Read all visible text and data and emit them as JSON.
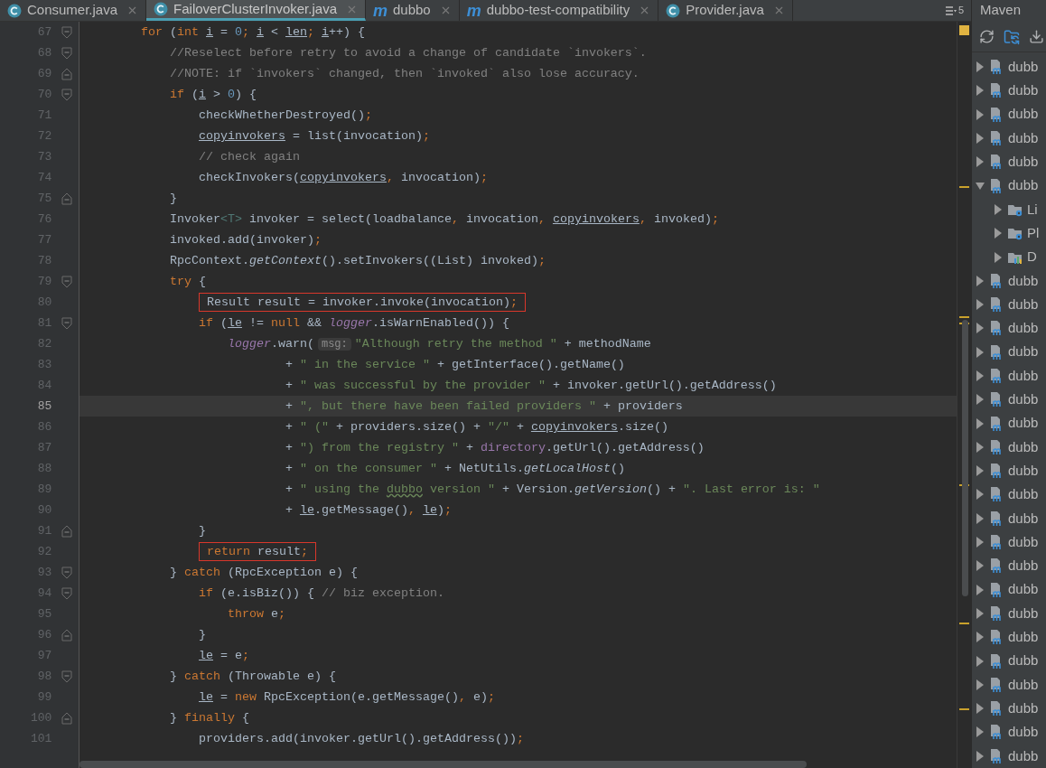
{
  "tabs": [
    {
      "label": "Consumer.java",
      "kind": "class",
      "selected": false
    },
    {
      "label": "FailoverClusterInvoker.java",
      "kind": "class",
      "selected": true
    },
    {
      "label": "dubbo",
      "kind": "maven",
      "icon_char": "m",
      "selected": false
    },
    {
      "label": "dubbo-test-compatibility",
      "kind": "maven",
      "icon_char": "m",
      "selected": false
    },
    {
      "label": "Provider.java",
      "kind": "class",
      "selected": false
    }
  ],
  "hidden_tab_count": "5",
  "editor": {
    "lines": [
      {
        "number": "67",
        "fold_open": true,
        "fold_close": false,
        "current": false,
        "boxed": false,
        "tokens": [
          {
            "kind": "kw",
            "text": "        for"
          },
          {
            "kind": "txt",
            "text": " ("
          },
          {
            "kind": "kw",
            "text": "int "
          },
          {
            "kind": "var",
            "text": "i"
          },
          {
            "kind": "txt",
            "text": " = "
          },
          {
            "kind": "num",
            "text": "0"
          },
          {
            "kind": "kw",
            "text": "; "
          },
          {
            "kind": "var",
            "text": "i"
          },
          {
            "kind": "txt",
            "text": " < "
          },
          {
            "kind": "var",
            "text": "len"
          },
          {
            "kind": "kw",
            "text": "; "
          },
          {
            "kind": "var",
            "text": "i"
          },
          {
            "kind": "txt",
            "text": "++) {"
          }
        ]
      },
      {
        "number": "68",
        "fold_open": true,
        "fold_close": false,
        "current": false,
        "boxed": false,
        "tokens": [
          {
            "kind": "cm",
            "text": "            //Reselect before retry to avoid a change of candidate `invokers`."
          }
        ]
      },
      {
        "number": "69",
        "fold_open": false,
        "fold_close": true,
        "current": false,
        "boxed": false,
        "tokens": [
          {
            "kind": "cm",
            "text": "            //NOTE: if `invokers` changed, then `invoked` also lose accuracy."
          }
        ]
      },
      {
        "number": "70",
        "fold_open": true,
        "fold_close": false,
        "current": false,
        "boxed": false,
        "tokens": [
          {
            "kind": "kw",
            "text": "            if"
          },
          {
            "kind": "txt",
            "text": " ("
          },
          {
            "kind": "var",
            "text": "i"
          },
          {
            "kind": "txt",
            "text": " > "
          },
          {
            "kind": "num",
            "text": "0"
          },
          {
            "kind": "txt",
            "text": ") {"
          }
        ]
      },
      {
        "number": "71",
        "fold_open": false,
        "fold_close": false,
        "current": false,
        "boxed": false,
        "tokens": [
          {
            "kind": "txt",
            "text": "                checkWhetherDestroyed()"
          },
          {
            "kind": "kw",
            "text": ";"
          }
        ]
      },
      {
        "number": "72",
        "fold_open": false,
        "fold_close": false,
        "current": false,
        "boxed": false,
        "tokens": [
          {
            "kind": "var",
            "text": "                copyinvokers"
          },
          {
            "kind": "txt",
            "text": " = list(invocation)"
          },
          {
            "kind": "kw",
            "text": ";"
          }
        ]
      },
      {
        "number": "73",
        "fold_open": false,
        "fold_close": false,
        "current": false,
        "boxed": false,
        "tokens": [
          {
            "kind": "cm",
            "text": "                // check again"
          }
        ]
      },
      {
        "number": "74",
        "fold_open": false,
        "fold_close": false,
        "current": false,
        "boxed": false,
        "tokens": [
          {
            "kind": "txt",
            "text": "                checkInvokers("
          },
          {
            "kind": "var",
            "text": "copyinvokers"
          },
          {
            "kind": "kw",
            "text": ", "
          },
          {
            "kind": "txt",
            "text": "invocation)"
          },
          {
            "kind": "kw",
            "text": ";"
          }
        ]
      },
      {
        "number": "75",
        "fold_open": false,
        "fold_close": true,
        "current": false,
        "boxed": false,
        "tokens": [
          {
            "kind": "txt",
            "text": "            }"
          }
        ]
      },
      {
        "number": "76",
        "fold_open": false,
        "fold_close": false,
        "current": false,
        "boxed": false,
        "tokens": [
          {
            "kind": "txt",
            "text": "            Invoker"
          },
          {
            "kind": "typ",
            "text": "<T>"
          },
          {
            "kind": "txt",
            "text": " invoker = select(loadbalance"
          },
          {
            "kind": "kw",
            "text": ", "
          },
          {
            "kind": "txt",
            "text": "invocation"
          },
          {
            "kind": "kw",
            "text": ", "
          },
          {
            "kind": "var",
            "text": "copyinvokers"
          },
          {
            "kind": "kw",
            "text": ", "
          },
          {
            "kind": "txt",
            "text": "invoked)"
          },
          {
            "kind": "kw",
            "text": ";"
          }
        ]
      },
      {
        "number": "77",
        "fold_open": false,
        "fold_close": false,
        "current": false,
        "boxed": false,
        "tokens": [
          {
            "kind": "txt",
            "text": "            invoked.add(invoker)"
          },
          {
            "kind": "kw",
            "text": ";"
          }
        ]
      },
      {
        "number": "78",
        "fold_open": false,
        "fold_close": false,
        "current": false,
        "boxed": false,
        "tokens": [
          {
            "kind": "txt",
            "text": "            RpcContext."
          },
          {
            "kind": "ital",
            "text": "getContext"
          },
          {
            "kind": "txt",
            "text": "().setInvokers((List) invoked)"
          },
          {
            "kind": "kw",
            "text": ";"
          }
        ]
      },
      {
        "number": "79",
        "fold_open": true,
        "fold_close": false,
        "current": false,
        "boxed": false,
        "tokens": [
          {
            "kind": "kw",
            "text": "            try"
          },
          {
            "kind": "txt",
            "text": " {"
          }
        ]
      },
      {
        "number": "80",
        "fold_open": false,
        "fold_close": false,
        "current": false,
        "boxed": true,
        "tokens": [
          {
            "kind": "txt",
            "text": "                Result result = invoker.invoke(invocation)"
          },
          {
            "kind": "kw",
            "text": ";"
          }
        ]
      },
      {
        "number": "81",
        "fold_open": true,
        "fold_close": false,
        "current": false,
        "boxed": false,
        "tokens": [
          {
            "kind": "kw",
            "text": "                if"
          },
          {
            "kind": "txt",
            "text": " ("
          },
          {
            "kind": "var",
            "text": "le"
          },
          {
            "kind": "txt",
            "text": " != "
          },
          {
            "kind": "kw",
            "text": "null"
          },
          {
            "kind": "txt",
            "text": " && "
          },
          {
            "kind": "fldi",
            "text": "logger"
          },
          {
            "kind": "txt",
            "text": ".isWarnEnabled()) {"
          }
        ]
      },
      {
        "number": "82",
        "fold_open": false,
        "fold_close": false,
        "current": false,
        "boxed": false,
        "tokens": [
          {
            "kind": "fldi",
            "text": "                    logger"
          },
          {
            "kind": "txt",
            "text": ".warn("
          },
          {
            "kind": "hint",
            "text": "msg:"
          },
          {
            "kind": "str",
            "text": "\"Although retry the method \""
          },
          {
            "kind": "txt",
            "text": " + methodName"
          }
        ]
      },
      {
        "number": "83",
        "fold_open": false,
        "fold_close": false,
        "current": false,
        "boxed": false,
        "tokens": [
          {
            "kind": "txt",
            "text": "                            + "
          },
          {
            "kind": "str",
            "text": "\" in the service \""
          },
          {
            "kind": "txt",
            "text": " + getInterface().getName()"
          }
        ]
      },
      {
        "number": "84",
        "fold_open": false,
        "fold_close": false,
        "current": false,
        "boxed": false,
        "tokens": [
          {
            "kind": "txt",
            "text": "                            + "
          },
          {
            "kind": "str",
            "text": "\" was successful by the provider \""
          },
          {
            "kind": "txt",
            "text": " + invoker.getUrl().getAddress()"
          }
        ]
      },
      {
        "number": "85",
        "fold_open": false,
        "fold_close": false,
        "current": true,
        "boxed": false,
        "tokens": [
          {
            "kind": "txt",
            "text": "                            + "
          },
          {
            "kind": "str",
            "text": "\", but there have been failed providers \""
          },
          {
            "kind": "txt",
            "text": " + providers"
          }
        ]
      },
      {
        "number": "86",
        "fold_open": false,
        "fold_close": false,
        "current": false,
        "boxed": false,
        "tokens": [
          {
            "kind": "txt",
            "text": "                            + "
          },
          {
            "kind": "str",
            "text": "\" (\""
          },
          {
            "kind": "txt",
            "text": " + providers.size() + "
          },
          {
            "kind": "str",
            "text": "\"/\""
          },
          {
            "kind": "txt",
            "text": " + "
          },
          {
            "kind": "var",
            "text": "copyinvokers"
          },
          {
            "kind": "txt",
            "text": ".size()"
          }
        ]
      },
      {
        "number": "87",
        "fold_open": false,
        "fold_close": false,
        "current": false,
        "boxed": false,
        "tokens": [
          {
            "kind": "txt",
            "text": "                            + "
          },
          {
            "kind": "str",
            "text": "\") from the registry \""
          },
          {
            "kind": "txt",
            "text": " + "
          },
          {
            "kind": "fld",
            "text": "directory"
          },
          {
            "kind": "txt",
            "text": ".getUrl().getAddress()"
          }
        ]
      },
      {
        "number": "88",
        "fold_open": false,
        "fold_close": false,
        "current": false,
        "boxed": false,
        "tokens": [
          {
            "kind": "txt",
            "text": "                            + "
          },
          {
            "kind": "str",
            "text": "\" on the consumer \""
          },
          {
            "kind": "txt",
            "text": " + NetUtils."
          },
          {
            "kind": "ital",
            "text": "getLocalHost"
          },
          {
            "kind": "txt",
            "text": "()"
          }
        ]
      },
      {
        "number": "89",
        "fold_open": false,
        "fold_close": false,
        "current": false,
        "boxed": false,
        "tokens": [
          {
            "kind": "txt",
            "text": "                            + "
          },
          {
            "kind": "str",
            "text": "\" using the "
          },
          {
            "kind": "typo",
            "text": "dubbo"
          },
          {
            "kind": "str",
            "text": " version \""
          },
          {
            "kind": "txt",
            "text": " + Version."
          },
          {
            "kind": "ital",
            "text": "getVersion"
          },
          {
            "kind": "txt",
            "text": "() + "
          },
          {
            "kind": "str",
            "text": "\". Last error is: \""
          }
        ]
      },
      {
        "number": "90",
        "fold_open": false,
        "fold_close": false,
        "current": false,
        "boxed": false,
        "tokens": [
          {
            "kind": "txt",
            "text": "                            + "
          },
          {
            "kind": "var",
            "text": "le"
          },
          {
            "kind": "txt",
            "text": ".getMessage()"
          },
          {
            "kind": "kw",
            "text": ", "
          },
          {
            "kind": "var",
            "text": "le"
          },
          {
            "kind": "txt",
            "text": ")"
          },
          {
            "kind": "kw",
            "text": ";"
          }
        ]
      },
      {
        "number": "91",
        "fold_open": false,
        "fold_close": true,
        "current": false,
        "boxed": false,
        "tokens": [
          {
            "kind": "txt",
            "text": "                }"
          }
        ]
      },
      {
        "number": "92",
        "fold_open": false,
        "fold_close": false,
        "current": false,
        "boxed": true,
        "tokens": [
          {
            "kind": "kw",
            "text": "                return"
          },
          {
            "kind": "txt",
            "text": " result"
          },
          {
            "kind": "kw",
            "text": ";"
          }
        ]
      },
      {
        "number": "93",
        "fold_open": true,
        "fold_close": false,
        "current": false,
        "boxed": false,
        "tokens": [
          {
            "kind": "txt",
            "text": "            } "
          },
          {
            "kind": "kw",
            "text": "catch"
          },
          {
            "kind": "txt",
            "text": " (RpcException e) {"
          }
        ]
      },
      {
        "number": "94",
        "fold_open": true,
        "fold_close": false,
        "current": false,
        "boxed": false,
        "tokens": [
          {
            "kind": "kw",
            "text": "                if"
          },
          {
            "kind": "txt",
            "text": " (e.isBiz()) { "
          },
          {
            "kind": "cm",
            "text": "// biz exception."
          }
        ]
      },
      {
        "number": "95",
        "fold_open": false,
        "fold_close": false,
        "current": false,
        "boxed": false,
        "tokens": [
          {
            "kind": "kw",
            "text": "                    throw"
          },
          {
            "kind": "txt",
            "text": " e"
          },
          {
            "kind": "kw",
            "text": ";"
          }
        ]
      },
      {
        "number": "96",
        "fold_open": false,
        "fold_close": true,
        "current": false,
        "boxed": false,
        "tokens": [
          {
            "kind": "txt",
            "text": "                }"
          }
        ]
      },
      {
        "number": "97",
        "fold_open": false,
        "fold_close": false,
        "current": false,
        "boxed": false,
        "tokens": [
          {
            "kind": "var",
            "text": "                le"
          },
          {
            "kind": "txt",
            "text": " = e"
          },
          {
            "kind": "kw",
            "text": ";"
          }
        ]
      },
      {
        "number": "98",
        "fold_open": true,
        "fold_close": false,
        "current": false,
        "boxed": false,
        "tokens": [
          {
            "kind": "txt",
            "text": "            } "
          },
          {
            "kind": "kw",
            "text": "catch"
          },
          {
            "kind": "txt",
            "text": " (Throwable e) {"
          }
        ]
      },
      {
        "number": "99",
        "fold_open": false,
        "fold_close": false,
        "current": false,
        "boxed": false,
        "tokens": [
          {
            "kind": "var",
            "text": "                le"
          },
          {
            "kind": "txt",
            "text": " = "
          },
          {
            "kind": "kw",
            "text": "new"
          },
          {
            "kind": "txt",
            "text": " RpcException(e.getMessage()"
          },
          {
            "kind": "kw",
            "text": ", "
          },
          {
            "kind": "txt",
            "text": "e)"
          },
          {
            "kind": "kw",
            "text": ";"
          }
        ]
      },
      {
        "number": "100",
        "fold_open": false,
        "fold_close": true,
        "current": false,
        "boxed": false,
        "tokens": [
          {
            "kind": "txt",
            "text": "            } "
          },
          {
            "kind": "kw",
            "text": "finally"
          },
          {
            "kind": "txt",
            "text": " {"
          }
        ]
      },
      {
        "number": "101",
        "fold_open": false,
        "fold_close": false,
        "current": false,
        "boxed": false,
        "tokens": [
          {
            "kind": "txt",
            "text": "                providers.add(invoker.getUrl().getAddress())"
          },
          {
            "kind": "kw",
            "text": ";"
          }
        ]
      }
    ]
  },
  "maven": {
    "title": "Maven",
    "items": [
      {
        "label": "dubb",
        "expanded": false
      },
      {
        "label": "dubb",
        "expanded": false
      },
      {
        "label": "dubb",
        "expanded": false
      },
      {
        "label": "dubb",
        "expanded": false
      },
      {
        "label": "dubb",
        "expanded": false
      },
      {
        "label": "dubb",
        "expanded": true,
        "children": [
          {
            "label": "Li",
            "kind": "gear-folder"
          },
          {
            "label": "Pl",
            "kind": "gear-folder"
          },
          {
            "label": "D",
            "kind": "chart-folder"
          }
        ]
      },
      {
        "label": "dubb",
        "expanded": false
      },
      {
        "label": "dubb",
        "expanded": false
      },
      {
        "label": "dubb",
        "expanded": false
      },
      {
        "label": "dubb",
        "expanded": false
      },
      {
        "label": "dubb",
        "expanded": false
      },
      {
        "label": "dubb",
        "expanded": false
      },
      {
        "label": "dubb",
        "expanded": false
      },
      {
        "label": "dubb",
        "expanded": false
      },
      {
        "label": "dubb",
        "expanded": false
      },
      {
        "label": "dubb",
        "expanded": false
      },
      {
        "label": "dubb",
        "expanded": false
      },
      {
        "label": "dubb",
        "expanded": false
      },
      {
        "label": "dubb",
        "expanded": false
      },
      {
        "label": "dubb",
        "expanded": false
      },
      {
        "label": "dubb",
        "expanded": false
      },
      {
        "label": "dubb",
        "expanded": false
      },
      {
        "label": "dubb",
        "expanded": false
      },
      {
        "label": "dubb",
        "expanded": false
      },
      {
        "label": "dubb",
        "expanded": false
      },
      {
        "label": "dubb",
        "expanded": false
      },
      {
        "label": "dubb",
        "expanded": false
      }
    ]
  }
}
